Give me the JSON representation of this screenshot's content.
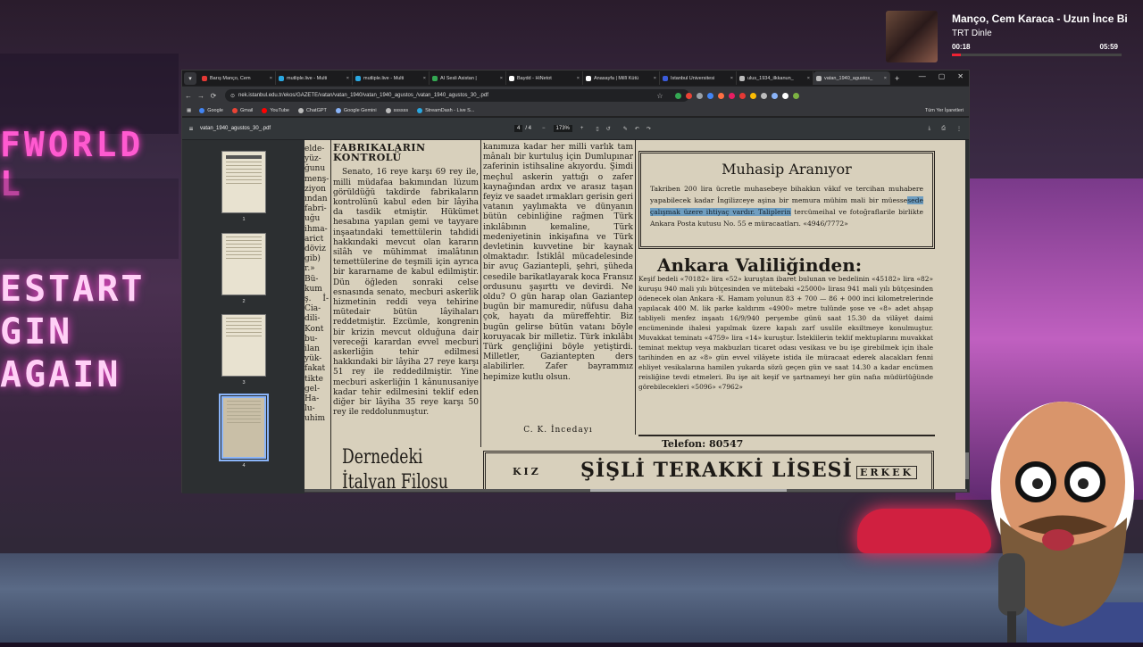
{
  "music": {
    "title": "Manço, Cem Karaca - Uzun İnce Bi",
    "station": "TRT Dinle",
    "elapsed": "00:18",
    "duration": "05:59",
    "progress": 0.05
  },
  "background": {
    "sign_top": "FWORLD L",
    "sign_mid_1": "ESTART",
    "sign_mid_2": "GIN AGAIN"
  },
  "browser": {
    "tabs": [
      {
        "label": "Barış Manço, Cem",
        "color": "#e53935",
        "active": false
      },
      {
        "label": "mutliple.live - Multi",
        "color": "#2aa7e0",
        "active": false
      },
      {
        "label": "mutliple.live - Multi",
        "color": "#2aa7e0",
        "active": false
      },
      {
        "label": "AI Sesli Asistan |",
        "color": "#34a853",
        "active": false
      },
      {
        "label": "Baydd - HiNetot",
        "color": "#ffffff",
        "active": false
      },
      {
        "label": "Anasayfa | Millî Kütü",
        "color": "#ffffff",
        "active": false
      },
      {
        "label": "İstanbul Üniversitesi",
        "color": "#3b5bdb",
        "active": false
      },
      {
        "label": "ulus_1934_ilkkanun_",
        "color": "#bbbbbb",
        "active": false
      },
      {
        "label": "vatan_1940_agustos_",
        "color": "#bbbbbb",
        "active": true
      }
    ],
    "url": "nek.istanbul.edu.tr/ekos/GAZETE/vatan/vatan_1940/vatan_1940_agustos_/vatan_1940_agustos_30_.pdf",
    "bookmarks": [
      {
        "label": "Google",
        "color": "#4285f4"
      },
      {
        "label": "Gmail",
        "color": "#ea4335"
      },
      {
        "label": "YouTube",
        "color": "#ff0000"
      },
      {
        "label": "ChatGPT",
        "color": "#bbbbbb"
      },
      {
        "label": "Google Gemini",
        "color": "#8ab4f8"
      },
      {
        "label": "ssssss",
        "color": "#bbbbbb"
      },
      {
        "label": "StreamDash - Live S...",
        "color": "#2aa7e0"
      }
    ],
    "all_bookmarks": "Tüm Yer İşaretleri"
  },
  "pdf": {
    "filename": "vatan_1940_agustos_30_.pdf",
    "current_page": "4",
    "total_pages": "/ 4",
    "zoom": "173%",
    "thumbnails": [
      "1",
      "2",
      "3",
      "4"
    ],
    "selected_page": "4"
  },
  "article": {
    "colA": "elde- yüz- ğunu menş- ziyon ından fabri- uğu ihma- arict döviz gib) r.» Bü- kum ş. İ- Cia- dili- Kont bu- ilan yük- fakat tikte gel- Ha- lu- uhim",
    "colB_heading": "FABRİKALARIN KONTROLÜ",
    "colB": "Senato, 16 reye karşı 69 rey ile, milli müdafaa bakımından lüzum görüldüğü takdirde fabrikaların kontrolünü kabul eden bir lâyiha da tasdik etmiştir. Hükümet hesabına yapılan gemi ve tayyare inşaatındaki temettülerin tahdidi hakkındaki mevcut olan kararın silâh ve mühimmat imalâtının temettülerine de teşmili için ayrıca bir kararname de kabul edilmiştir. Dün öğleden sonraki celse esnasında senato, mecburi askerlik hizmetinin reddi veya tehirine mütedair bütün lâyihaları reddetmiştir. Ezcümle, kongrenin bir krizin mevcut olduğuna dair vereceği karardan evvel mecburi askerliğin tehir edilmesi hakkındaki bir lâyiha 27 reye karşı 51 rey ile reddedilmiştir. Yine mecburi askerliğin 1 kânunusaniye kadar tehir edilmesini teklif eden diğer bir lâyiha 35 reye karşı 50 rey ile reddolunmuştur.",
    "colC": "kanımıza kadar her milli varlık tam mânalı bir kurtuluş için Dumlupınar zaferinin istihsaline akıyordu. Şimdi meçhul askerin yattığı o zafer kaynağından ardıx ve arasız taşan feyiz ve saadet ırmakları gerisin geri vatanın yaylımakta ve dünyanın bütün cebinliğine rağmen Türk inkılâbının kemaline, Türk medeniyetinin inkişafına ve Türk devletinin kuvvetine bir kaynak olmaktadır. İstiklâl mücadelesinde bir avuç Gaziantepli, şehri, şüheda cesedile barikatlayarak koca Fransız ordusunu şaşırttı ve devirdi. Ne oldu? O gün harap olan Gaziantep bugün bir mamuredir, nüfusu daha çok, hayatı da müreffehtir. Biz bugün gelirse bütün vatanı böyle koruyacak bir milletiz. Türk inkılâbı Türk gençliğini böyle yetiştirdi. Milletler, Gaziantepten ders alabilirler. Zafer bayrammız hepimize kutlu olsun.",
    "colC_sig": "C. K. İncedayı",
    "box_title": "Muhasip Aranıyor",
    "box_text_1": "Takriben 200 lira ücretle muhasebeye bihakkın vâkıf ve tercihan muhabere yapabilecek kadar İngilizceye aşina bir memura mühim mali bir müesse",
    "box_text_hl": "sede çalışmak üzere ihtiyaç vardır. Taliplerin",
    "box_text_2": "tercümeihal ve fotoğraflarile birlikte Ankara Posta kutusu No. 55 e müracaatları. «4946/7772»",
    "vilayet_title": "Ankara Valiliğinden:",
    "vilayet_text": "Keşif bedeli «70182» lira «52» kuruştan ibaret bulunan ve bedelinin «45182» lira «82» kuruşu 940 mali yılı bütçesinden ve mütebaki «25000» lirası 941 mali yılı bütçesinden ödenecek olan Ankara -K. Hamam yolunun 83 + 700 — 86 + 000 inci kilometrelerinde yapılacak 400 M. lik parke kaldırım «4900» metre tulünde şose ve «8» adet ahşap tabliyeli menfez inşaatı 16/9/940 perşembe günü saat 15.30 da vilâyet daimi encümeninde ihalesi yapılmak üzere kapalı zarf usulile eksiltmeye konulmuştur. Muvakkat teminatı «4759» lira «14» kuruştur. İsteklilerin teklif mektuplarını muvakkat teminat mektup veya makbuzları ticaret odası vesikası ve bu işe girebilmek için ihale tarihinden en az «8» gün evvel vilâyete istida ile müracaat ederek alacakları fenni ehliyet vesikalarına hamilen yukarda sözü geçen gün ve saat 14.30 a kadar encümen reisliğine tevdi etmeleri. Bu işe ait keşif ve şartnameyi her gün nafıa müdürlüğünde görebilecekleri «5096» «7962»",
    "telefon": "Telefon: 80547",
    "lise_left": "KIZ",
    "lise_name": "ŞİŞLİ TERAKKİ LİSESİ",
    "lise_right": "ERKEK",
    "italyan": "Dernedeki İtalyan Filosu Bombalandı"
  }
}
